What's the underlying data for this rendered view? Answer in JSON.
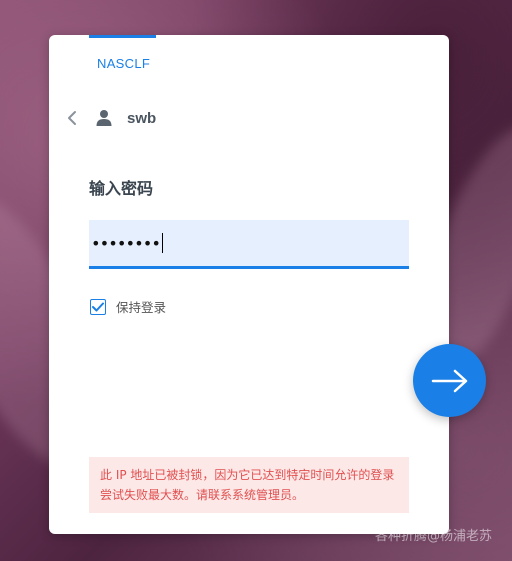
{
  "header": {
    "brand": "NASCLF"
  },
  "user": {
    "name": "swb"
  },
  "password": {
    "title": "输入密码",
    "value": "••••••••"
  },
  "keep_login": {
    "label": "保持登录",
    "checked": true
  },
  "error": {
    "message": "此 IP 地址已被封锁，因为它已达到特定时间允许的登录尝试失败最大数。请联系系统管理员。"
  },
  "watermark": {
    "text": "各种折腾@杨浦老苏"
  },
  "icons": {
    "back": "chevron-left-icon",
    "user": "person-icon",
    "check": "checkmark-icon",
    "next": "arrow-right-icon"
  },
  "colors": {
    "accent": "#1a7fe6",
    "error_text": "#e05050",
    "error_bg": "#fde8e8",
    "field_bg": "#e6effd"
  }
}
